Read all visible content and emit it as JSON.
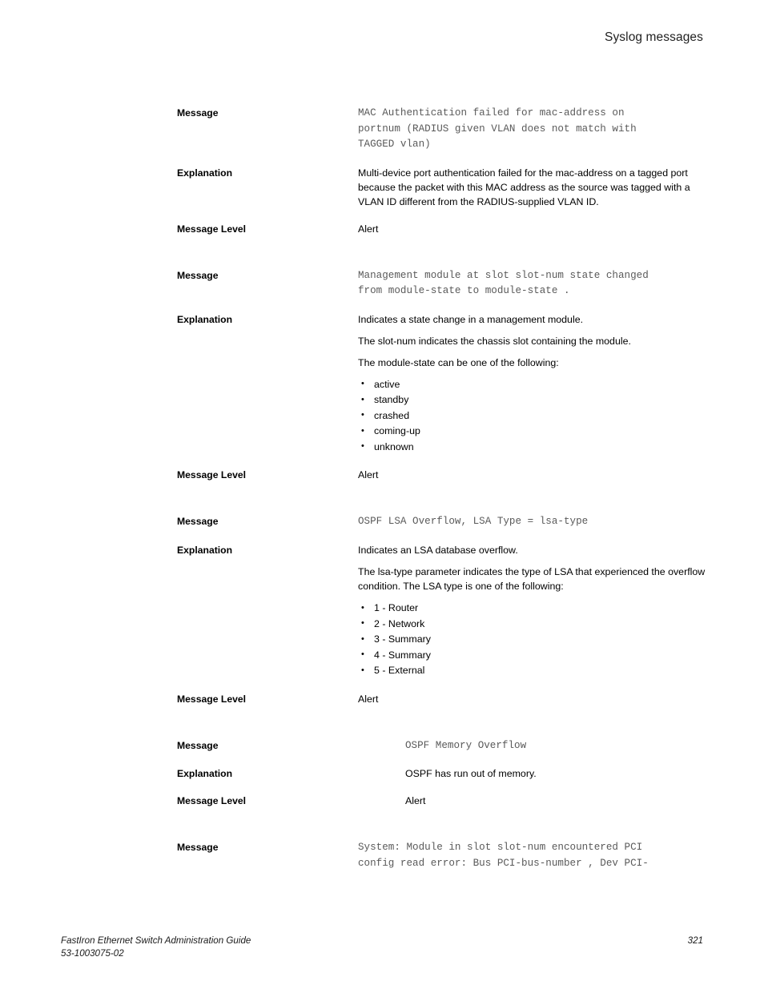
{
  "header": {
    "running_head": "Syslog messages"
  },
  "labels": {
    "message": "Message",
    "explanation": "Explanation",
    "message_level": "Message Level"
  },
  "blocks": [
    {
      "id": "mac-authentication-failed-tagged-vlan",
      "indent": "normal",
      "message": "MAC Authentication failed for mac-address on\nportnum (RADIUS given VLAN does not match with\nTAGGED vlan)",
      "explanation_paragraphs": [
        "Multi-device port authentication failed for the mac-address on a tagged port because the packet with this MAC address as the source was tagged with a VLAN ID different from the RADIUS-supplied VLAN ID."
      ],
      "bullets": [],
      "message_level": "Alert"
    },
    {
      "id": "management-module-state-changed",
      "indent": "normal",
      "message": "Management module at slot slot-num state changed\nfrom module-state to module-state .",
      "explanation_paragraphs": [
        "Indicates a state change in a management module.",
        "The slot-num indicates the chassis slot containing the module.",
        "The module-state can be one of the following:"
      ],
      "bullets": [
        "active",
        "standby",
        "crashed",
        "coming-up",
        "unknown"
      ],
      "message_level": "Alert"
    },
    {
      "id": "ospf-lsa-overflow",
      "indent": "normal",
      "message": "OSPF LSA Overflow, LSA Type = lsa-type",
      "explanation_paragraphs": [
        "Indicates an LSA database overflow.",
        "The lsa-type parameter indicates the type of LSA that experienced the overflow condition. The LSA type is one of the following:"
      ],
      "bullets": [
        "1 - Router",
        "2 - Network",
        "3 - Summary",
        "4 - Summary",
        "5 - External"
      ],
      "message_level": "Alert"
    },
    {
      "id": "ospf-memory-overflow",
      "indent": "wide",
      "message": "OSPF Memory Overflow",
      "explanation_paragraphs": [
        "OSPF has run out of memory."
      ],
      "bullets": [],
      "message_level": "Alert"
    },
    {
      "id": "system-module-pci-config-read-error",
      "indent": "normal",
      "message": "System: Module in slot slot-num encountered PCI\nconfig read error: Bus PCI-bus-number , Dev PCI-",
      "explanation_paragraphs": [],
      "bullets": [],
      "message_level": null
    }
  ],
  "footer": {
    "guide_title": "FastIron Ethernet Switch Administration Guide",
    "document_number": "53-1003075-02",
    "page_number": "321"
  }
}
